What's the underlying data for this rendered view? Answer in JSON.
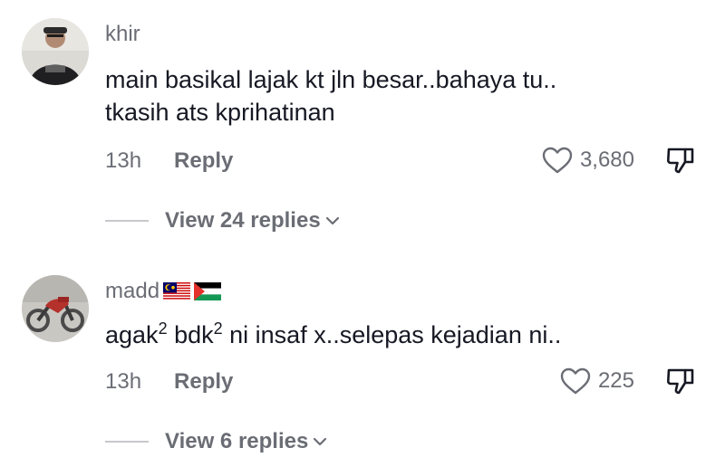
{
  "comments": [
    {
      "username": "khir",
      "text_line1": "main basikal lajak kt jln besar..bahaya tu..",
      "text_line2": "tkasih ats kprihatinan",
      "time": "13h",
      "reply_label": "Reply",
      "likes": "3,680",
      "view_replies": "View 24 replies",
      "avatar_icon": "person-avatar-icon"
    },
    {
      "username": "madd",
      "flags": [
        "malaysia-flag-icon",
        "palestine-flag-icon"
      ],
      "text_parts": [
        "agak",
        "2",
        " bdk",
        "2",
        " ni insaf x..selepas kejadian ni.."
      ],
      "time": "13h",
      "reply_label": "Reply",
      "likes": "225",
      "view_replies": "View 6 replies",
      "avatar_icon": "motorcycle-avatar-icon"
    }
  ],
  "colors": {
    "text_primary": "#161823",
    "text_secondary": "#6b6d75",
    "divider": "#c8c8cc"
  }
}
